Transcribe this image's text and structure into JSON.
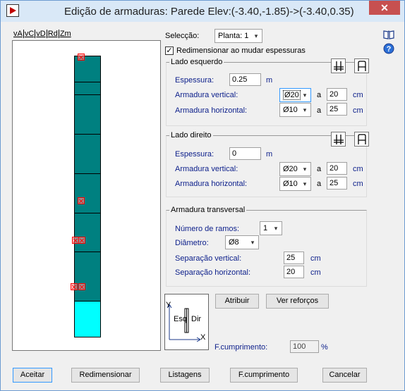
{
  "window": {
    "title": "Edição de armaduras: Parede Elev:(-3.40,-1.85)->(-3.40,0.35)",
    "close_label": "✕"
  },
  "view_tabs": [
    "vA",
    "vC",
    "vD",
    "Rd",
    "Zm"
  ],
  "selection": {
    "label": "Selecção:",
    "value": "Planta: 1"
  },
  "resize_checkbox": {
    "label": "Redimensionar ao mudar espessuras",
    "checked": true
  },
  "left_side": {
    "title": "Lado esquerdo",
    "thickness_label": "Espessura:",
    "thickness_value": "0.25",
    "thickness_unit": "m",
    "vertical_label": "Armadura vertical:",
    "vertical_diameter": "Ø20",
    "vertical_a": "a",
    "vertical_spacing": "20",
    "vertical_unit": "cm",
    "horizontal_label": "Armadura horizontal:",
    "horizontal_diameter": "Ø10",
    "horizontal_a": "a",
    "horizontal_spacing": "25",
    "horizontal_unit": "cm"
  },
  "right_side": {
    "title": "Lado direito",
    "thickness_label": "Espessura:",
    "thickness_value": "0",
    "thickness_unit": "m",
    "vertical_label": "Armadura vertical:",
    "vertical_diameter": "Ø20",
    "vertical_a": "a",
    "vertical_spacing": "20",
    "vertical_unit": "cm",
    "horizontal_label": "Armadura horizontal:",
    "horizontal_diameter": "Ø10",
    "horizontal_a": "a",
    "horizontal_spacing": "25",
    "horizontal_unit": "cm"
  },
  "transversal": {
    "title": "Armadura transversal",
    "branches_label": "Número de ramos:",
    "branches_value": "1",
    "diameter_label": "Diâmetro:",
    "diameter_value": "Ø8",
    "vsep_label": "Separação vertical:",
    "vsep_value": "25",
    "vsep_unit": "cm",
    "hsep_label": "Separação horizontal:",
    "hsep_value": "20",
    "hsep_unit": "cm"
  },
  "actions": {
    "assign": "Atribuir",
    "view_reinforcements": "Ver reforços"
  },
  "diagram": {
    "y": "Y",
    "x": "X",
    "left": "Esq",
    "right": "Dir"
  },
  "fcompr": {
    "label": "F.cumprimento:",
    "value": "100",
    "unit": "%"
  },
  "bottom_buttons": {
    "accept": "Aceitar",
    "resize": "Redimensionar",
    "listings": "Listagens",
    "fcompr": "F.cumprimento",
    "cancel": "Cancelar"
  },
  "colors": {
    "wall": "#008080",
    "wall_bottom": "#00ffff",
    "mark": "#ff0000",
    "title_bar": "#d9e8f7",
    "close": "#c75050"
  },
  "icons": {
    "app": "play-icon",
    "help_book": "book-icon",
    "help": "help-icon",
    "rebar_a": "rebar-layout-a-icon",
    "rebar_b": "rebar-layout-b-icon"
  }
}
